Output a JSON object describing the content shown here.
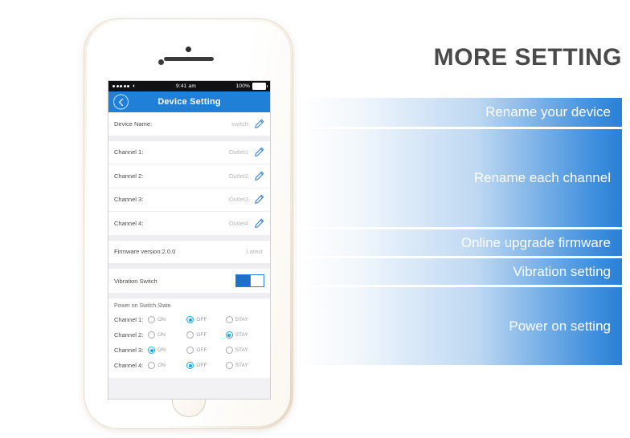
{
  "headline": "MORE SETTING",
  "phone": {
    "status_bar": {
      "signal_icon": "signal-dots-icon",
      "wifi_icon": "wifi-icon",
      "time": "9:41 am",
      "battery_percent": "100%",
      "battery_icon": "battery-icon"
    },
    "nav": {
      "back_icon": "chevron-left-icon",
      "title": "Device Setting"
    },
    "device_name_row": {
      "label": "Device Name:",
      "value": "switch",
      "edit_icon": "pencil-icon"
    },
    "channel_rows": [
      {
        "label": "Channel 1:",
        "value": "Outlet1",
        "edit_icon": "pencil-icon"
      },
      {
        "label": "Channel 2:",
        "value": "Outlet2",
        "edit_icon": "pencil-icon"
      },
      {
        "label": "Channel 3:",
        "value": "Outlet3",
        "edit_icon": "pencil-icon"
      },
      {
        "label": "Channel 4:",
        "value": "Outlet4",
        "edit_icon": "pencil-icon"
      }
    ],
    "firmware_row": {
      "label": "Firmware version:2.0.0",
      "value": "Latest"
    },
    "vibration_row": {
      "label": "Vibration Switch",
      "toggle_state": "on"
    },
    "power_on": {
      "title": "Power on Switch State",
      "options": [
        "ON",
        "OFF",
        "STAY"
      ],
      "rows": [
        {
          "label": "Channel 1:",
          "selected": "OFF"
        },
        {
          "label": "Channel 2:",
          "selected": "STAY"
        },
        {
          "label": "Channel 3:",
          "selected": "ON"
        },
        {
          "label": "Channel 4:",
          "selected": "OFF"
        }
      ]
    }
  },
  "banners": [
    {
      "text": "Rename your device"
    },
    {
      "text": "Rename each channel"
    },
    {
      "text": "Online upgrade firmware"
    },
    {
      "text": "Vibration setting"
    },
    {
      "text": "Power on setting"
    }
  ],
  "colors": {
    "nav_blue": "#2080d8",
    "banner_blue": "#2b7fd6",
    "radio_active": "#1aa8e8",
    "toggle_on": "#1f6fc6",
    "headline_gray": "#4a4a4a"
  }
}
